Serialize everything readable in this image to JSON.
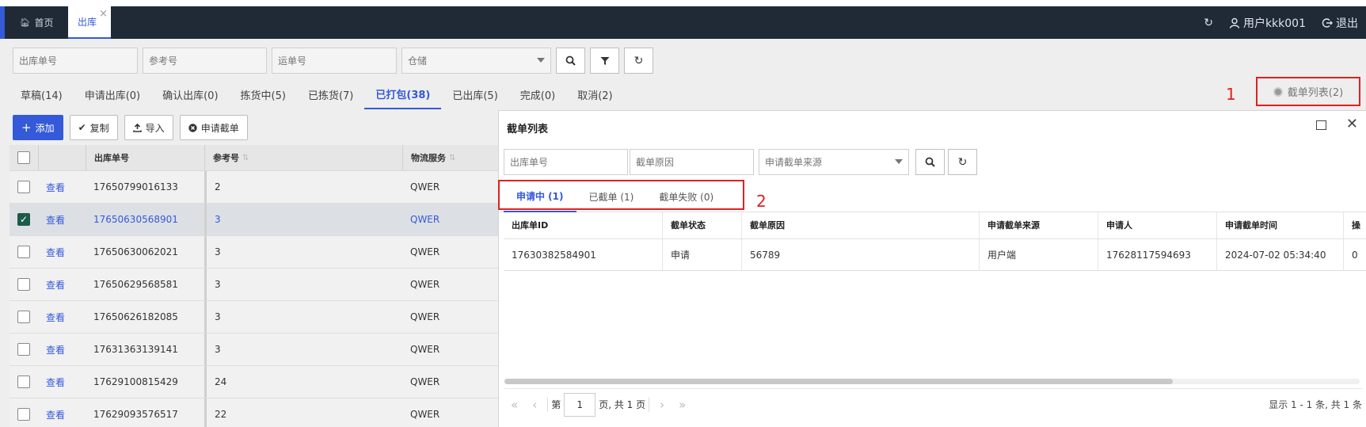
{
  "topbar": {
    "home_label": "首页",
    "active_tab_label": "出库",
    "close_glyph": "×",
    "user_label": "用户kkk001",
    "logout_label": "退出"
  },
  "filters": {
    "outbound_no_placeholder": "出库单号",
    "ref_no_placeholder": "参考号",
    "tracking_no_placeholder": "运单号",
    "warehouse_placeholder": "仓储"
  },
  "status_tabs": [
    {
      "label": "草稿(14)"
    },
    {
      "label": "申请出库(0)"
    },
    {
      "label": "确认出库(0)"
    },
    {
      "label": "拣货中(5)"
    },
    {
      "label": "已拣货(7)"
    },
    {
      "label": "已打包(38)"
    },
    {
      "label": "已出库(5)"
    },
    {
      "label": "完成(0)"
    },
    {
      "label": "取消(2)"
    }
  ],
  "intercept_list_link": "截单列表(2)",
  "annotations": {
    "one": "1",
    "two": "2"
  },
  "actions": {
    "add": "添加",
    "copy": "复制",
    "import": "导入",
    "apply_intercept": "申请截单"
  },
  "table": {
    "headers": {
      "id": "出库单号",
      "ref": "参考号",
      "logistics": "物流服务"
    },
    "view_label": "查看",
    "rows": [
      {
        "id": "17650799016133",
        "ref": "2",
        "logistics": "QWER",
        "checked": false
      },
      {
        "id": "17650630568901",
        "ref": "3",
        "logistics": "QWER",
        "checked": true
      },
      {
        "id": "17650630062021",
        "ref": "3",
        "logistics": "QWER",
        "checked": false
      },
      {
        "id": "17650629568581",
        "ref": "3",
        "logistics": "QWER",
        "checked": false
      },
      {
        "id": "17650626182085",
        "ref": "3",
        "logistics": "QWER",
        "checked": false
      },
      {
        "id": "17631363139141",
        "ref": "3",
        "logistics": "QWER",
        "checked": false
      },
      {
        "id": "17629100815429",
        "ref": "24",
        "logistics": "QWER",
        "checked": false
      },
      {
        "id": "17629093576517",
        "ref": "22",
        "logistics": "QWER",
        "checked": false
      }
    ]
  },
  "modal": {
    "title": "截单列表",
    "filters": {
      "outbound_no_placeholder": "出库单号",
      "reason_placeholder": "截单原因",
      "source_placeholder": "申请截单来源"
    },
    "tabs": [
      {
        "label": "申请中 (1)"
      },
      {
        "label": "已截单 (1)"
      },
      {
        "label": "截单失败 (0)"
      }
    ],
    "headers": [
      "出库单ID",
      "截单状态",
      "截单原因",
      "申请截单来源",
      "申请人",
      "申请截单时间",
      "操"
    ],
    "rows": [
      [
        "17630382584901",
        "申请",
        "56789",
        "用户端",
        "17628117594693",
        "2024-07-02 05:34:40",
        "0"
      ]
    ],
    "pager": {
      "prefix": "第",
      "page": "1",
      "suffix": "页, 共 1 页",
      "info": "显示 1 - 1 条, 共 1 条"
    }
  },
  "colors": {
    "primary": "#3459d9",
    "topbar": "#1f2a36",
    "annotation": "#e02020"
  }
}
